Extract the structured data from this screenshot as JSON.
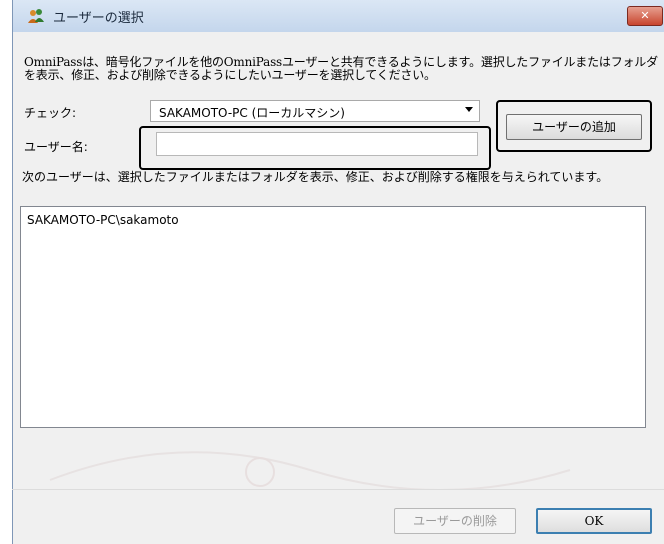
{
  "window": {
    "title": "ユーザーの選択",
    "close_label": "✕"
  },
  "description": "OmniPassは、暗号化ファイルを他のOmniPassユーザーと共有できるようにします。選択したファイルまたはフォルダを表示、修正、および削除できるようにしたいユーザーを選択してください。",
  "check": {
    "label": "チェック:",
    "selected": "SAKAMOTO-PC (ローカルマシン)"
  },
  "username": {
    "label": "ユーザー名:",
    "value": "",
    "placeholder": ""
  },
  "add_button": "ユーザーの追加",
  "info_text": "次のユーザーは、選択したファイルまたはフォルダを表示、修正、および削除する権限を与えられています。",
  "users": [
    "SAKAMOTO-PC\\sakamoto"
  ],
  "footer": {
    "delete_button": "ユーザーの削除",
    "ok_button": "OK"
  },
  "colors": {
    "title_bar": "#c4d6ec",
    "close_button": "#c8452f",
    "ok_border": "#3c7fb1"
  }
}
